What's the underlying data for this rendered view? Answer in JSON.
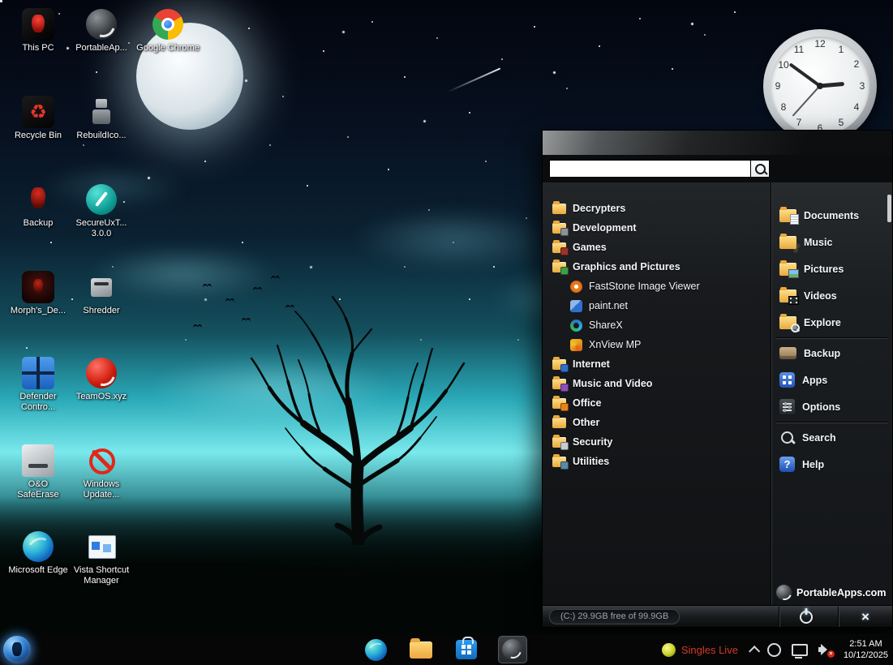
{
  "desktop_icons": [
    {
      "label": "This PC"
    },
    {
      "label": "PortableAp..."
    },
    {
      "label": "Google Chrome"
    },
    {
      "label": "Recycle Bin"
    },
    {
      "label": "RebuildIco..."
    },
    {
      "label": "Backup"
    },
    {
      "label": "SecureUxT... 3.0.0"
    },
    {
      "label": "Morph's_De..."
    },
    {
      "label": "Shredder"
    },
    {
      "label": "Defender Contro..."
    },
    {
      "label": "TeamOS.xyz"
    },
    {
      "label": "O&O SafeErase"
    },
    {
      "label": "Windows Update..."
    },
    {
      "label": "Microsoft Edge"
    },
    {
      "label": "Vista Shortcut Manager"
    }
  ],
  "clock_widget": {
    "numbers": [
      "12",
      "1",
      "2",
      "3",
      "4",
      "5",
      "6",
      "7",
      "8",
      "9",
      "10",
      "11"
    ]
  },
  "menu": {
    "search_value": "",
    "categories": [
      {
        "label": "Decrypters"
      },
      {
        "label": "Development"
      },
      {
        "label": "Games"
      },
      {
        "label": "Graphics and Pictures"
      },
      {
        "label": "FastStone Image Viewer"
      },
      {
        "label": "paint.net"
      },
      {
        "label": "ShareX"
      },
      {
        "label": "XnView MP"
      },
      {
        "label": "Internet"
      },
      {
        "label": "Music and Video"
      },
      {
        "label": "Office"
      },
      {
        "label": "Other"
      },
      {
        "label": "Security"
      },
      {
        "label": "Utilities"
      }
    ],
    "right_items": [
      {
        "label": "Documents"
      },
      {
        "label": "Music"
      },
      {
        "label": "Pictures"
      },
      {
        "label": "Videos"
      },
      {
        "label": "Explore"
      },
      {
        "label": "Backup"
      },
      {
        "label": "Apps"
      },
      {
        "label": "Options"
      },
      {
        "label": "Search"
      },
      {
        "label": "Help"
      }
    ],
    "brand": "PortableApps.com",
    "status": "(C:) 29.9GB free of 99.9GB"
  },
  "taskbar": {
    "tray_app_label": "Singles Live",
    "time": "2:51 AM",
    "date": "10/12/2025"
  },
  "glyphs": {
    "close": "×",
    "help": "?",
    "music_note": "♪",
    "recycle": "♻"
  },
  "icons": {
    "search": "magnifier",
    "power": "power-symbol",
    "folder": "yellow-folder",
    "portableapps_logo": "dark-globe-swirl"
  }
}
